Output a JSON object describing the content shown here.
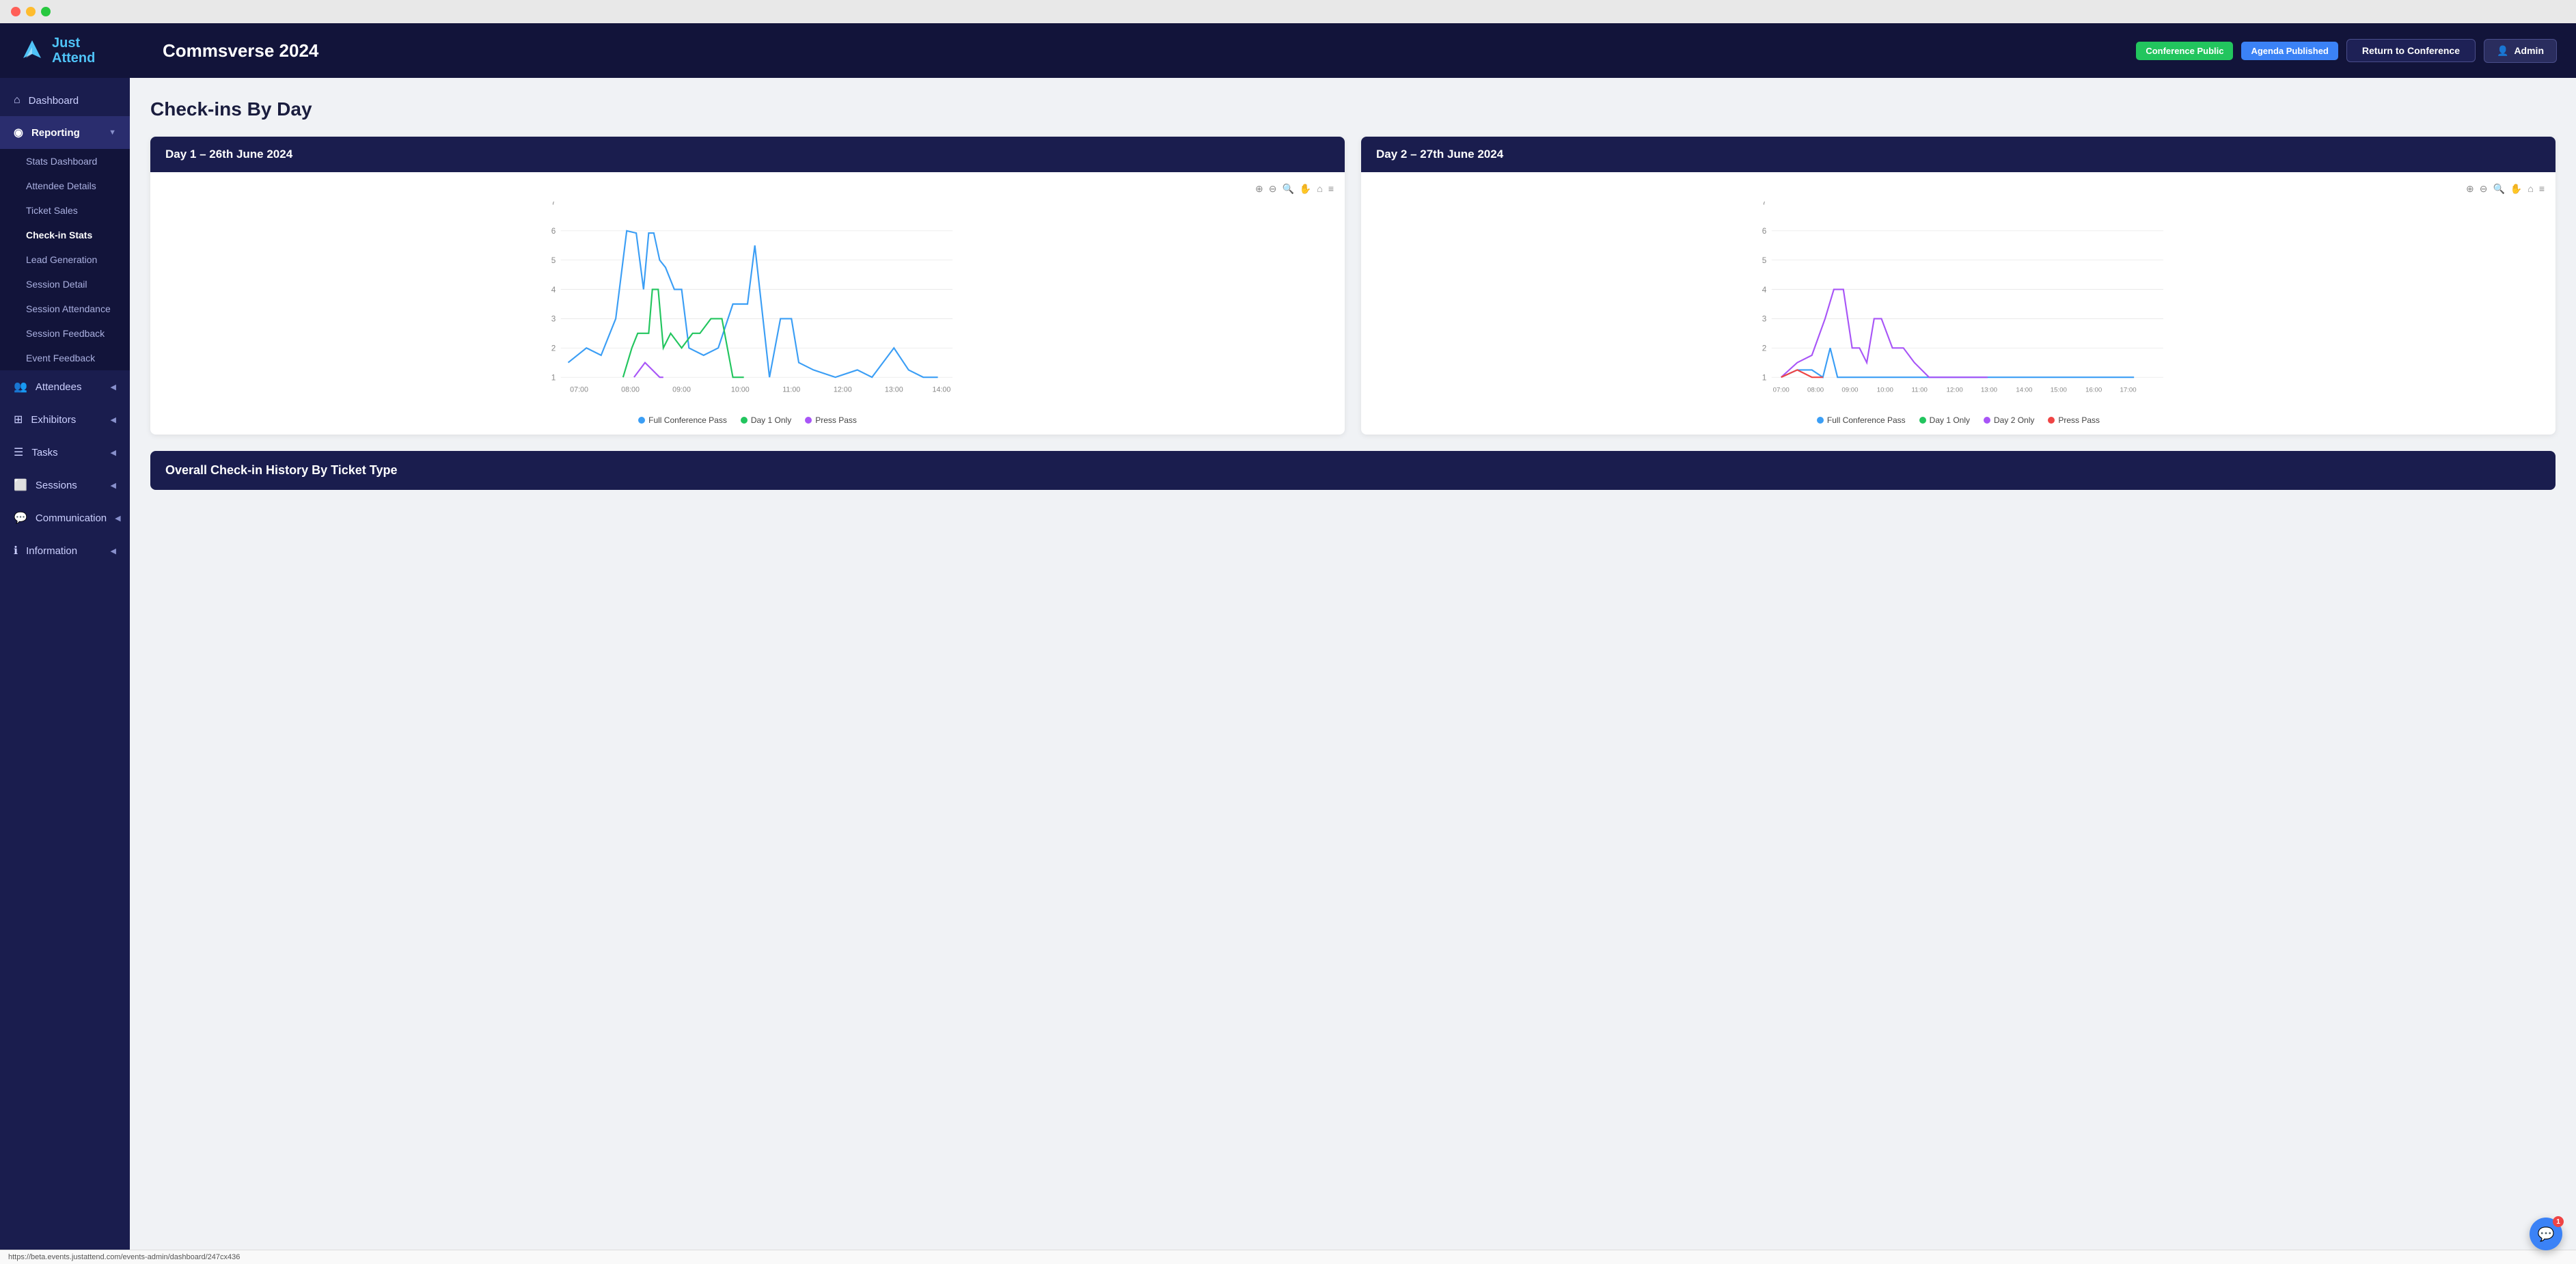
{
  "window": {
    "dots": [
      "#ff5f57",
      "#febc2e",
      "#28c840"
    ],
    "url": "https://beta.events.justattend.com/events-admin/dashboard/247cx436"
  },
  "header": {
    "logo_top": "Just",
    "logo_bottom": "Attend",
    "title": "Commsverse 2024",
    "badge_public": "Conference Public",
    "badge_agenda": "Agenda Published",
    "btn_return": "Return to Conference",
    "btn_admin": "Admin"
  },
  "sidebar": {
    "items": [
      {
        "label": "Dashboard",
        "icon": "⌂",
        "arrow": false,
        "active": false
      },
      {
        "label": "Reporting",
        "icon": "◉",
        "arrow": true,
        "active": true
      },
      {
        "label": "Attendees",
        "icon": "👥",
        "arrow": true,
        "active": false
      },
      {
        "label": "Exhibitors",
        "icon": "⊞",
        "arrow": true,
        "active": false
      },
      {
        "label": "Tasks",
        "icon": "☰",
        "arrow": true,
        "active": false
      },
      {
        "label": "Sessions",
        "icon": "⬜",
        "arrow": true,
        "active": false
      },
      {
        "label": "Communication",
        "icon": "💬",
        "arrow": true,
        "active": false
      },
      {
        "label": "Information",
        "icon": "ℹ",
        "arrow": true,
        "active": false
      }
    ],
    "sub_items": [
      {
        "label": "Stats Dashboard",
        "active": false
      },
      {
        "label": "Attendee Details",
        "active": false
      },
      {
        "label": "Ticket Sales",
        "active": false
      },
      {
        "label": "Check-in Stats",
        "active": true
      },
      {
        "label": "Lead Generation",
        "active": false
      },
      {
        "label": "Session Detail",
        "active": false
      },
      {
        "label": "Session Attendance",
        "active": false
      },
      {
        "label": "Session Feedback",
        "active": false
      },
      {
        "label": "Event Feedback",
        "active": false
      }
    ]
  },
  "page": {
    "title": "Check-ins By Day"
  },
  "chart1": {
    "header": "Day 1 – 26th June 2024",
    "yMax": 7,
    "xLabels": [
      "07:00",
      "08:00",
      "09:00",
      "10:00",
      "11:00",
      "12:00",
      "13:00",
      "14:00"
    ],
    "legend": [
      {
        "label": "Full Conference Pass",
        "color": "#3b9ef5"
      },
      {
        "label": "Day 1 Only",
        "color": "#22c55e"
      },
      {
        "label": "Press Pass",
        "color": "#a855f7"
      }
    ]
  },
  "chart2": {
    "header": "Day 2 – 27th June 2024",
    "yMax": 7,
    "xLabels": [
      "07:00",
      "08:00",
      "09:00",
      "10:00",
      "11:00",
      "12:00",
      "13:00",
      "14:00",
      "15:00",
      "16:00",
      "17:00"
    ],
    "legend": [
      {
        "label": "Full Conference Pass",
        "color": "#3b9ef5"
      },
      {
        "label": "Day 1 Only",
        "color": "#22c55e"
      },
      {
        "label": "Day 2 Only",
        "color": "#a855f7"
      },
      {
        "label": "Press Pass",
        "color": "#ef4444"
      }
    ]
  },
  "bottom": {
    "title": "Overall Check-in History By Ticket Type"
  },
  "chat": {
    "badge": "1"
  }
}
